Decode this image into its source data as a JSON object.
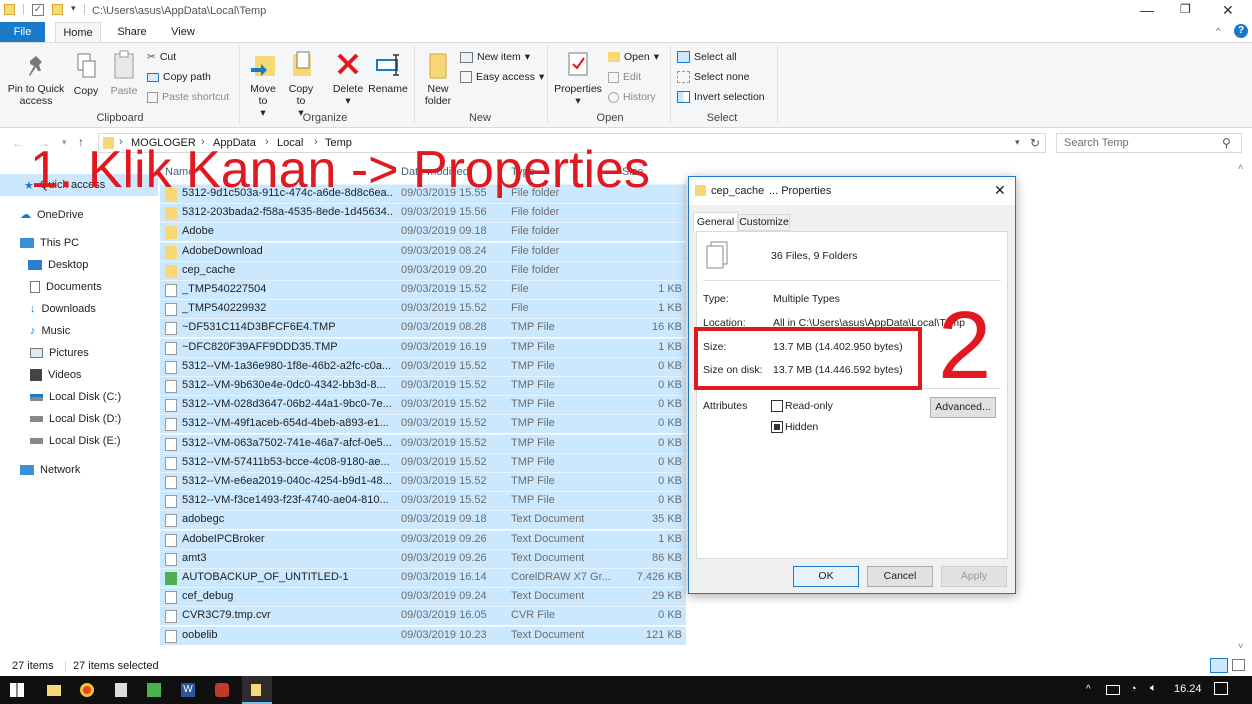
{
  "window": {
    "path": "C:\\Users\\asus\\AppData\\Local\\Temp"
  },
  "ribbon_tabs": [
    "File",
    "Home",
    "Share",
    "View"
  ],
  "ribbon": {
    "pin": "Pin to Quick access",
    "copy": "Copy",
    "paste": "Paste",
    "cut": "Cut",
    "copy_path": "Copy path",
    "paste_shortcut": "Paste shortcut",
    "move_to": "Move to",
    "copy_to": "Copy to",
    "delete": "Delete",
    "rename": "Rename",
    "new_folder": "New folder",
    "new_item": "New item",
    "easy_access": "Easy access",
    "properties": "Properties",
    "open": "Open",
    "edit": "Edit",
    "history": "History",
    "select_all": "Select all",
    "select_none": "Select none",
    "invert_selection": "Invert selection",
    "groups": {
      "clipboard": "Clipboard",
      "organize": "Organize",
      "new": "New",
      "open": "Open",
      "select": "Select"
    }
  },
  "breadcrumb": [
    "MOGLOGER",
    "AppData",
    "Local",
    "Temp"
  ],
  "search_placeholder": "Search Temp",
  "columns": {
    "name": "Name",
    "date": "Date modified",
    "type": "Type",
    "size": "Size"
  },
  "nav": {
    "quick_access": "Quick access",
    "onedrive": "OneDrive",
    "this_pc": "This PC",
    "desktop": "Desktop",
    "documents": "Documents",
    "downloads": "Downloads",
    "music": "Music",
    "pictures": "Pictures",
    "videos": "Videos",
    "disk_c": "Local Disk (C:)",
    "disk_d": "Local Disk (D:)",
    "disk_e": "Local Disk (E:)",
    "network": "Network"
  },
  "files": [
    {
      "name": "5312-9d1c503a-911c-474c-a6de-8d8c6ea...",
      "date": "09/03/2019 15.55",
      "type": "File folder",
      "size": "",
      "kind": "folder"
    },
    {
      "name": "5312-203bada2-f58a-4535-8ede-1d45634...",
      "date": "09/03/2019 15.56",
      "type": "File folder",
      "size": "",
      "kind": "folder"
    },
    {
      "name": "Adobe",
      "date": "09/03/2019 09.18",
      "type": "File folder",
      "size": "",
      "kind": "folder"
    },
    {
      "name": "AdobeDownload",
      "date": "09/03/2019 08.24",
      "type": "File folder",
      "size": "",
      "kind": "folder"
    },
    {
      "name": "cep_cache",
      "date": "09/03/2019 09.20",
      "type": "File folder",
      "size": "",
      "kind": "folder"
    },
    {
      "name": "_TMP540227504",
      "date": "09/03/2019 15.52",
      "type": "File",
      "size": "1 KB",
      "kind": "file"
    },
    {
      "name": "_TMP540229932",
      "date": "09/03/2019 15.52",
      "type": "File",
      "size": "1 KB",
      "kind": "file"
    },
    {
      "name": "~DF531C114D3BFCF6E4.TMP",
      "date": "09/03/2019 08.28",
      "type": "TMP File",
      "size": "16 KB",
      "kind": "file"
    },
    {
      "name": "~DFC820F39AFF9DDD35.TMP",
      "date": "09/03/2019 16.19",
      "type": "TMP File",
      "size": "1 KB",
      "kind": "file"
    },
    {
      "name": "5312--VM-1a36e980-1f8e-46b2-a2fc-c0a...",
      "date": "09/03/2019 15.52",
      "type": "TMP File",
      "size": "0 KB",
      "kind": "file"
    },
    {
      "name": "5312--VM-9b630e4e-0dc0-4342-bb3d-8...",
      "date": "09/03/2019 15.52",
      "type": "TMP File",
      "size": "0 KB",
      "kind": "file"
    },
    {
      "name": "5312--VM-028d3647-06b2-44a1-9bc0-7e...",
      "date": "09/03/2019 15.52",
      "type": "TMP File",
      "size": "0 KB",
      "kind": "file"
    },
    {
      "name": "5312--VM-49f1aceb-654d-4beb-a893-e1...",
      "date": "09/03/2019 15.52",
      "type": "TMP File",
      "size": "0 KB",
      "kind": "file"
    },
    {
      "name": "5312--VM-063a7502-741e-46a7-afcf-0e5...",
      "date": "09/03/2019 15.52",
      "type": "TMP File",
      "size": "0 KB",
      "kind": "file"
    },
    {
      "name": "5312--VM-57411b53-bcce-4c08-9180-ae...",
      "date": "09/03/2019 15.52",
      "type": "TMP File",
      "size": "0 KB",
      "kind": "file"
    },
    {
      "name": "5312--VM-e6ea2019-040c-4254-b9d1-48...",
      "date": "09/03/2019 15.52",
      "type": "TMP File",
      "size": "0 KB",
      "kind": "file"
    },
    {
      "name": "5312--VM-f3ce1493-f23f-4740-ae04-810...",
      "date": "09/03/2019 15.52",
      "type": "TMP File",
      "size": "0 KB",
      "kind": "file"
    },
    {
      "name": "adobegc",
      "date": "09/03/2019 09.18",
      "type": "Text Document",
      "size": "35 KB",
      "kind": "text"
    },
    {
      "name": "AdobeIPCBroker",
      "date": "09/03/2019 09.26",
      "type": "Text Document",
      "size": "1 KB",
      "kind": "text"
    },
    {
      "name": "amt3",
      "date": "09/03/2019 09.26",
      "type": "Text Document",
      "size": "86 KB",
      "kind": "text"
    },
    {
      "name": "AUTOBACKUP_OF_UNTITLED-1",
      "date": "09/03/2019 16.14",
      "type": "CorelDRAW X7 Gr...",
      "size": "7.426 KB",
      "kind": "cdr"
    },
    {
      "name": "cef_debug",
      "date": "09/03/2019 09.24",
      "type": "Text Document",
      "size": "29 KB",
      "kind": "text"
    },
    {
      "name": "CVR3C79.tmp.cvr",
      "date": "09/03/2019 16.05",
      "type": "CVR File",
      "size": "0 KB",
      "kind": "file"
    },
    {
      "name": "oobelib",
      "date": "09/03/2019 10.23",
      "type": "Text Document",
      "size": "121 KB",
      "kind": "text"
    }
  ],
  "status": {
    "count": "27 items",
    "selected": "27 items selected"
  },
  "dialog": {
    "title": "... Properties",
    "title_prefix": "cep_cache",
    "tab_general": "General",
    "tab_customize": "Customize",
    "summary": "36 Files, 9 Folders",
    "type_label": "Type:",
    "type_value": "Multiple Types",
    "location_label": "Location:",
    "location_value": "All in C:\\Users\\asus\\AppData\\Local\\Temp",
    "size_label": "Size:",
    "size_value": "13.7 MB (14.402.950 bytes)",
    "size_disk_label": "Size on disk:",
    "size_disk_value": "13.7 MB (14.446.592 bytes)",
    "attributes_label": "Attributes",
    "readonly": "Read-only",
    "hidden": "Hidden",
    "advanced": "Advanced...",
    "ok": "OK",
    "cancel": "Cancel",
    "apply": "Apply"
  },
  "annotations": {
    "step1": "1. Klik Kanan -> Properties",
    "step2": "2"
  },
  "taskbar": {
    "time": "16.24"
  },
  "colors": {
    "accent": "#1979ca",
    "selection": "#cce8ff",
    "annotation": "#e0181f",
    "folder": "#f8d775"
  }
}
